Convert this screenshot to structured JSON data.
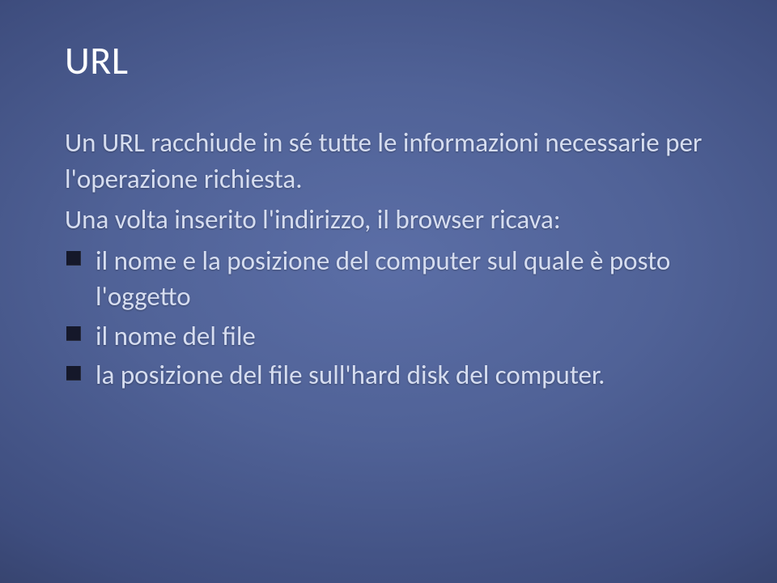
{
  "title": "URL",
  "intro": {
    "line1": "Un URL racchiude in sé tutte le informazioni necessarie per l'operazione richiesta.",
    "line2": "Una volta inserito l'indirizzo, il browser ricava:"
  },
  "bullets": [
    "il nome e la posizione del computer sul quale è posto l'oggetto",
    "il nome del file",
    "la posizione del file sull'hard disk del computer."
  ]
}
